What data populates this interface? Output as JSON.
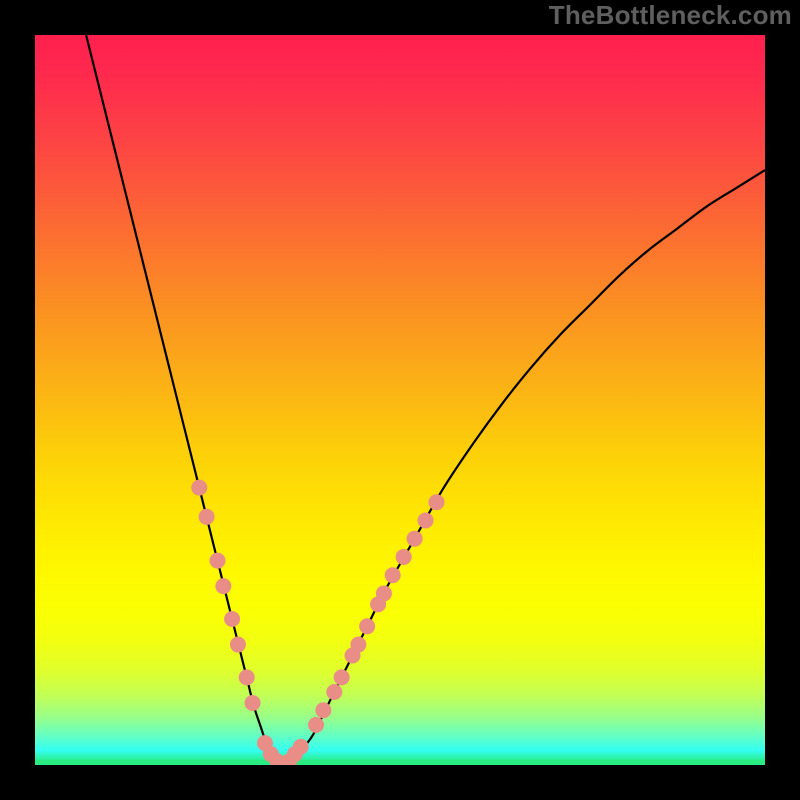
{
  "watermark": "TheBottleneck.com",
  "colors": {
    "frame": "#000000",
    "curve": "#000000",
    "markers": "#e98d87",
    "gradient_stops": [
      {
        "offset": 0.0,
        "color": "#ff1f4e"
      },
      {
        "offset": 0.06,
        "color": "#fe2b4d"
      },
      {
        "offset": 0.14,
        "color": "#fd4245"
      },
      {
        "offset": 0.24,
        "color": "#fc6336"
      },
      {
        "offset": 0.36,
        "color": "#fb8c24"
      },
      {
        "offset": 0.48,
        "color": "#fbb215"
      },
      {
        "offset": 0.58,
        "color": "#fdd208"
      },
      {
        "offset": 0.67,
        "color": "#feea02"
      },
      {
        "offset": 0.74,
        "color": "#fef900"
      },
      {
        "offset": 0.79,
        "color": "#fbff03"
      },
      {
        "offset": 0.83,
        "color": "#f2ff11"
      },
      {
        "offset": 0.87,
        "color": "#e0ff2c"
      },
      {
        "offset": 0.905,
        "color": "#c2ff56"
      },
      {
        "offset": 0.935,
        "color": "#98ff8a"
      },
      {
        "offset": 0.96,
        "color": "#63ffc3"
      },
      {
        "offset": 0.98,
        "color": "#34fff0"
      },
      {
        "offset": 0.996,
        "color": "#28ec82"
      },
      {
        "offset": 1.0,
        "color": "#28ec82"
      }
    ],
    "green_band": {
      "y_top_frac": 0.993,
      "color": "#28ec82"
    }
  },
  "chart_data": {
    "type": "line",
    "title": "",
    "xlabel": "",
    "ylabel": "",
    "xlim": [
      0,
      100
    ],
    "ylim": [
      0,
      100
    ],
    "legend": false,
    "grid": false,
    "series": [
      {
        "name": "bottleneck-curve",
        "x": [
          7,
          9,
          11,
          13,
          15,
          17,
          19,
          21,
          23,
          25,
          26,
          27,
          28,
          29,
          30,
          31,
          32,
          33,
          34,
          35,
          36,
          38,
          40,
          42,
          44,
          46,
          48,
          52,
          56,
          60,
          64,
          68,
          72,
          76,
          80,
          84,
          88,
          92,
          96,
          100
        ],
        "y": [
          100,
          92,
          84,
          76,
          68,
          60,
          52,
          44,
          36,
          28,
          24,
          20,
          16,
          12,
          8,
          5,
          2,
          0,
          0,
          0.5,
          1.5,
          4,
          8,
          12,
          16,
          20,
          24,
          31,
          38,
          44,
          49.5,
          54.5,
          59,
          63,
          67,
          70.5,
          73.5,
          76.5,
          79,
          81.5
        ]
      }
    ],
    "marker_clusters": [
      {
        "name": "left-descent-markers",
        "points": [
          {
            "x": 22.5,
            "y": 38
          },
          {
            "x": 23.5,
            "y": 34
          },
          {
            "x": 25.0,
            "y": 28
          },
          {
            "x": 25.8,
            "y": 24.5
          },
          {
            "x": 27.0,
            "y": 20
          },
          {
            "x": 27.8,
            "y": 16.5
          },
          {
            "x": 29.0,
            "y": 12
          },
          {
            "x": 29.8,
            "y": 8.5
          }
        ]
      },
      {
        "name": "trough-markers",
        "points": [
          {
            "x": 31.5,
            "y": 3.0
          },
          {
            "x": 32.3,
            "y": 1.5
          },
          {
            "x": 33.2,
            "y": 0.5
          },
          {
            "x": 34.0,
            "y": 0.0
          },
          {
            "x": 34.8,
            "y": 0.5
          },
          {
            "x": 35.6,
            "y": 1.5
          },
          {
            "x": 36.4,
            "y": 2.5
          }
        ]
      },
      {
        "name": "right-ascent-markers",
        "points": [
          {
            "x": 38.5,
            "y": 5.5
          },
          {
            "x": 39.5,
            "y": 7.5
          },
          {
            "x": 41.0,
            "y": 10
          },
          {
            "x": 42.0,
            "y": 12
          },
          {
            "x": 43.5,
            "y": 15
          },
          {
            "x": 44.3,
            "y": 16.5
          },
          {
            "x": 45.5,
            "y": 19
          },
          {
            "x": 47.0,
            "y": 22
          },
          {
            "x": 47.8,
            "y": 23.5
          },
          {
            "x": 49.0,
            "y": 26
          },
          {
            "x": 50.5,
            "y": 28.5
          },
          {
            "x": 52.0,
            "y": 31
          },
          {
            "x": 53.5,
            "y": 33.5
          },
          {
            "x": 55.0,
            "y": 36
          }
        ]
      }
    ]
  }
}
